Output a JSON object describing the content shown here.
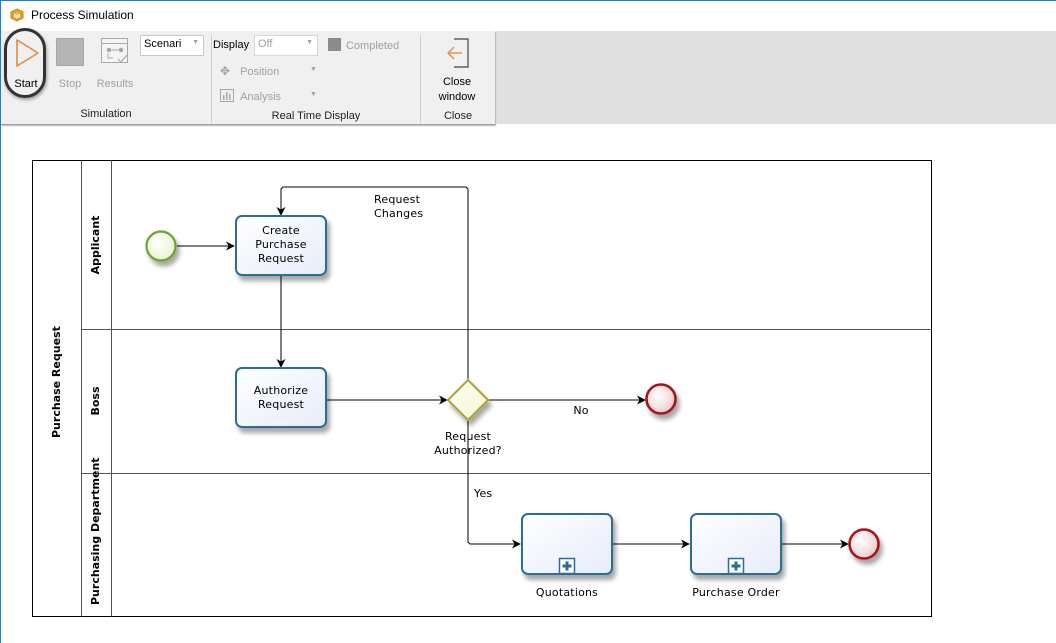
{
  "window": {
    "title": "Process Simulation",
    "accent_color": "#1883d7",
    "app_icon": "cube-icon"
  },
  "ribbon": {
    "groups": [
      {
        "label": "Simulation",
        "buttons": [
          {
            "label": "Start",
            "icon": "play-icon",
            "enabled": true,
            "highlighted": true
          },
          {
            "label": "Stop",
            "icon": "stop-icon",
            "enabled": false
          },
          {
            "label": "Results",
            "icon": "results-icon",
            "enabled": false
          }
        ],
        "scenario_combo": {
          "value": "Scenari"
        }
      },
      {
        "label": "Real Time Display",
        "display_label": "Display",
        "display_combo": {
          "value": "Off"
        },
        "completed_label": "Completed",
        "position_label": "Position",
        "analysis_label": "Analysis"
      },
      {
        "label": "Close",
        "buttons": [
          {
            "label_line1": "Close",
            "label_line2": "window",
            "icon": "close-window-icon"
          }
        ]
      }
    ]
  },
  "diagram": {
    "pool": {
      "label": "Purchase Request"
    },
    "lanes": [
      {
        "label": "Applicant"
      },
      {
        "label": "Boss"
      },
      {
        "label": "Purchasing Department"
      }
    ],
    "tasks": [
      {
        "id": "create",
        "lines": [
          "Create",
          "Purchase",
          "Request"
        ]
      },
      {
        "id": "authorize",
        "lines": [
          "Authorize",
          "Request"
        ]
      },
      {
        "id": "quotations",
        "label": "Quotations",
        "subprocess": true
      },
      {
        "id": "purchase-order",
        "label": "Purchase Order",
        "subprocess": true
      }
    ],
    "gateway": {
      "lines": [
        "Request",
        "Authorized?"
      ]
    },
    "flow_labels": {
      "request_changes": [
        "Request",
        "Changes"
      ],
      "no": "No",
      "yes": "Yes"
    },
    "colors": {
      "start_event": "#6aa325",
      "end_event": "#a3161a",
      "task_border": "#2b6d96",
      "gateway_border": "#a9a43a"
    }
  }
}
